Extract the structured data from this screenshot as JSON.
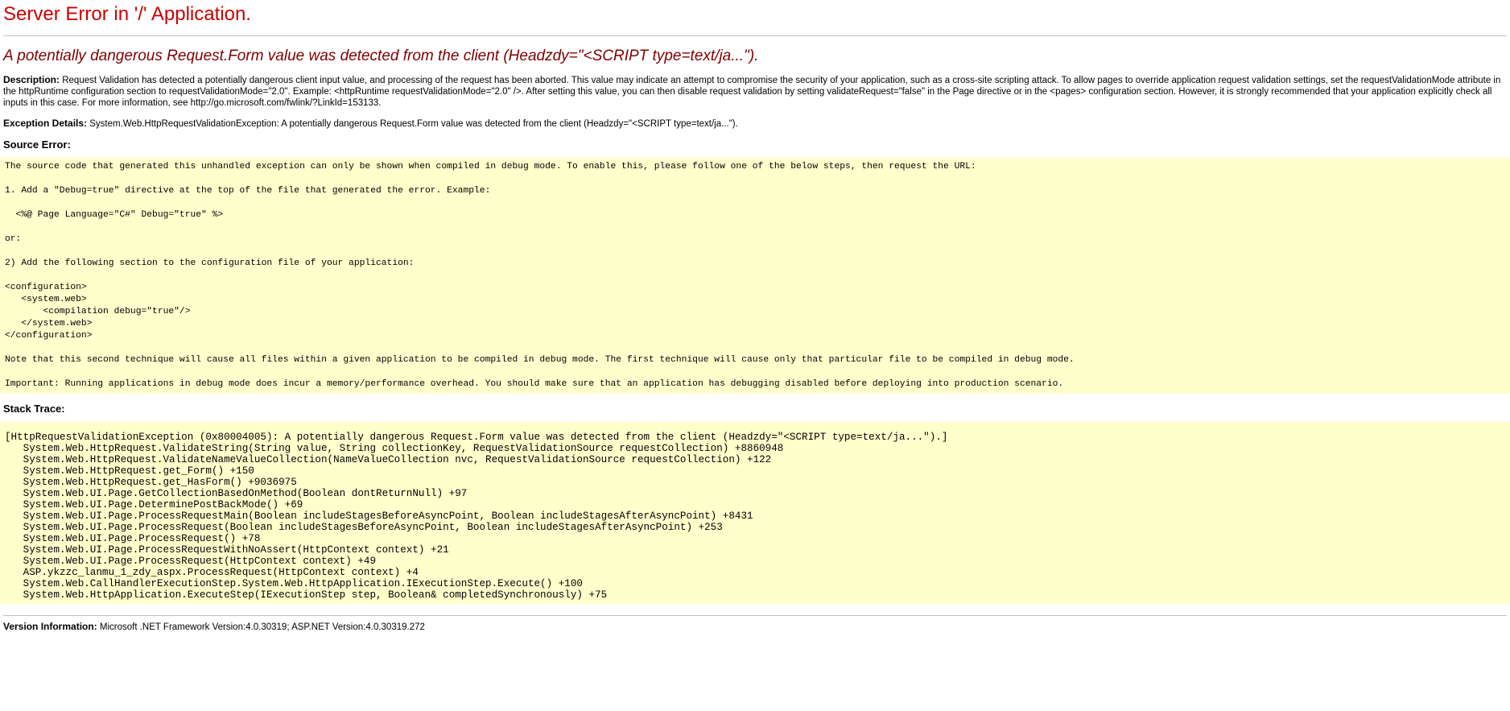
{
  "title": "Server Error in '/' Application.",
  "subtitle": "A potentially dangerous Request.Form value was detected from the client (Headzdy=\"<SCRIPT type=text/ja...\").",
  "description": {
    "label": "Description:",
    "text": "Request Validation has detected a potentially dangerous client input value, and processing of the request has been aborted. This value may indicate an attempt to compromise the security of your application, such as a cross-site scripting attack. To allow pages to override application request validation settings, set the requestValidationMode attribute in the httpRuntime configuration section to requestValidationMode=\"2.0\". Example: <httpRuntime requestValidationMode=\"2.0\" />. After setting this value, you can then disable request validation by setting validateRequest=\"false\" in the Page directive or in the <pages> configuration section. However, it is strongly recommended that your application explicitly check all inputs in this case. For more information, see http://go.microsoft.com/fwlink/?LinkId=153133."
  },
  "exception": {
    "label": "Exception Details:",
    "text": "System.Web.HttpRequestValidationException: A potentially dangerous Request.Form value was detected from the client (Headzdy=\"<SCRIPT type=text/ja...\")."
  },
  "source_error": {
    "label": "Source Error:",
    "lines": [
      "The source code that generated this unhandled exception can only be shown when compiled in debug mode. To enable this, please follow one of the below steps, then request the URL:",
      "",
      "1. Add a \"Debug=true\" directive at the top of the file that generated the error. Example:",
      "",
      "  <%@ Page Language=\"C#\" Debug=\"true\" %>",
      "",
      "or:",
      "",
      "2) Add the following section to the configuration file of your application:",
      "",
      "<configuration>",
      "   <system.web>",
      "       <compilation debug=\"true\"/>",
      "   </system.web>",
      "</configuration>",
      "",
      "Note that this second technique will cause all files within a given application to be compiled in debug mode. The first technique will cause only that particular file to be compiled in debug mode.",
      "",
      "Important: Running applications in debug mode does incur a memory/performance overhead. You should make sure that an application has debugging disabled before deploying into production scenario."
    ]
  },
  "stack_trace": {
    "label": "Stack Trace:",
    "lines": [
      "[HttpRequestValidationException (0x80004005): A potentially dangerous Request.Form value was detected from the client (Headzdy=\"<SCRIPT type=text/ja...\").]",
      "   System.Web.HttpRequest.ValidateString(String value, String collectionKey, RequestValidationSource requestCollection) +8860948",
      "   System.Web.HttpRequest.ValidateNameValueCollection(NameValueCollection nvc, RequestValidationSource requestCollection) +122",
      "   System.Web.HttpRequest.get_Form() +150",
      "   System.Web.HttpRequest.get_HasForm() +9036975",
      "   System.Web.UI.Page.GetCollectionBasedOnMethod(Boolean dontReturnNull) +97",
      "   System.Web.UI.Page.DeterminePostBackMode() +69",
      "   System.Web.UI.Page.ProcessRequestMain(Boolean includeStagesBeforeAsyncPoint, Boolean includeStagesAfterAsyncPoint) +8431",
      "   System.Web.UI.Page.ProcessRequest(Boolean includeStagesBeforeAsyncPoint, Boolean includeStagesAfterAsyncPoint) +253",
      "   System.Web.UI.Page.ProcessRequest() +78",
      "   System.Web.UI.Page.ProcessRequestWithNoAssert(HttpContext context) +21",
      "   System.Web.UI.Page.ProcessRequest(HttpContext context) +49",
      "   ASP.ykzzc_lanmu_1_zdy_aspx.ProcessRequest(HttpContext context) +4",
      "   System.Web.CallHandlerExecutionStep.System.Web.HttpApplication.IExecutionStep.Execute() +100",
      "   System.Web.HttpApplication.ExecuteStep(IExecutionStep step, Boolean& completedSynchronously) +75"
    ]
  },
  "version": {
    "label": "Version Information:",
    "text": "Microsoft .NET Framework Version:4.0.30319; ASP.NET Version:4.0.30319.272"
  },
  "colors": {
    "title": "#cc0000",
    "subtitle": "#800000",
    "code_background": "#ffffcc",
    "rule": "#c0c0c0"
  }
}
